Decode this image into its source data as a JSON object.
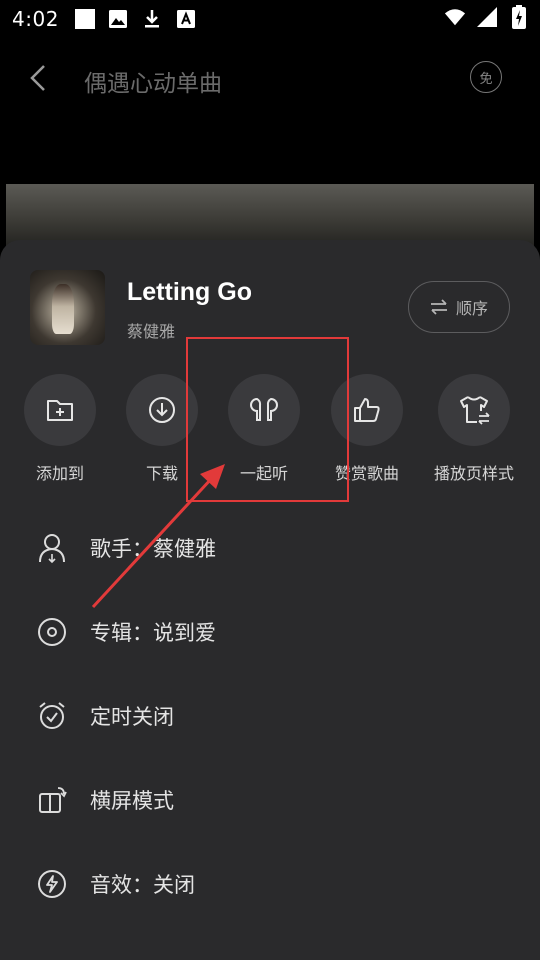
{
  "status_bar": {
    "time": "4:02",
    "left_icons": [
      "square-notification-icon",
      "image-icon",
      "download-icon",
      "font-app-icon"
    ],
    "right_icons": [
      "wifi-icon",
      "signal-icon",
      "battery-charging-icon"
    ]
  },
  "top_bar": {
    "title": "偶遇心动单曲",
    "free_badge": "免"
  },
  "song": {
    "title": "Letting Go",
    "artist": "蔡健雅",
    "order_label": "顺序"
  },
  "actions": [
    {
      "label": "添加到",
      "icon": "folder-add-icon"
    },
    {
      "label": "下载",
      "icon": "download-circle-icon"
    },
    {
      "label": "一起听",
      "icon": "earbuds-icon"
    },
    {
      "label": "赞赏歌曲",
      "icon": "thumbs-up-icon"
    },
    {
      "label": "播放页样式",
      "icon": "tshirt-swap-icon"
    }
  ],
  "menu": [
    {
      "label": "歌手：蔡健雅",
      "icon": "singer-icon"
    },
    {
      "label": "专辑：说到爱",
      "icon": "album-disc-icon"
    },
    {
      "label": "定时关闭",
      "icon": "alarm-clock-icon"
    },
    {
      "label": "横屏模式",
      "icon": "landscape-rotate-icon"
    },
    {
      "label": "音效：关闭",
      "icon": "sound-effect-icon"
    }
  ],
  "colors": {
    "sheet_bg": "#2a2a2c",
    "action_circle": "#3a3a3d",
    "annotation_red": "#e23a3a"
  }
}
